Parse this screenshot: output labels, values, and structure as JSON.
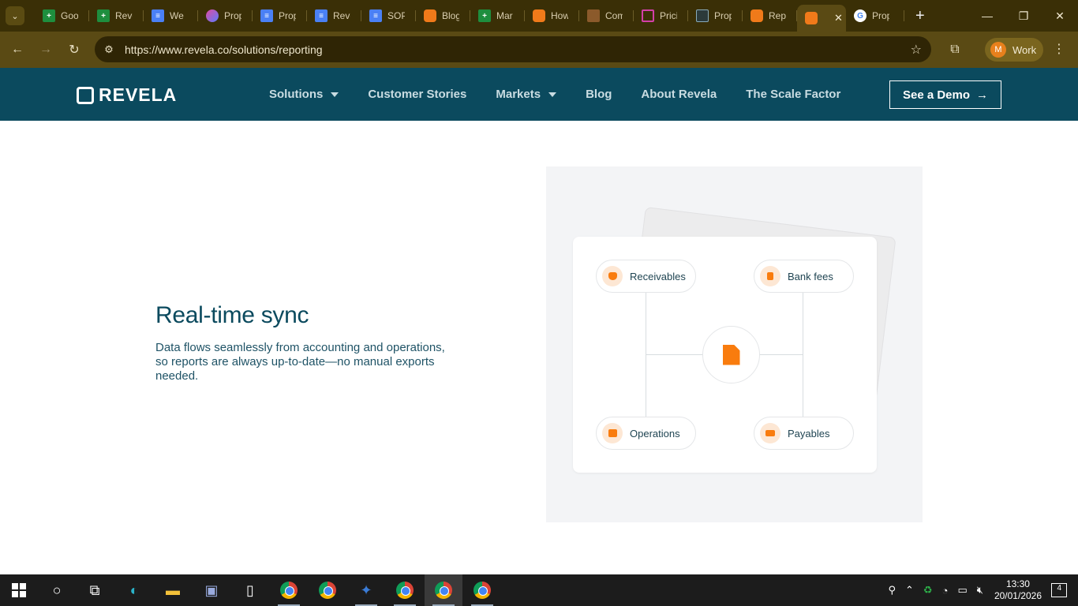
{
  "browser": {
    "tabs": [
      {
        "label": "Goo",
        "icon": "sheets-icon"
      },
      {
        "label": "Reve",
        "icon": "sheets-icon"
      },
      {
        "label": "We",
        "icon": "docs-icon"
      },
      {
        "label": "Prop",
        "icon": "gemini-icon"
      },
      {
        "label": "Prop",
        "icon": "docs-icon"
      },
      {
        "label": "Reve",
        "icon": "docs-icon"
      },
      {
        "label": "SOP",
        "icon": "docs-icon"
      },
      {
        "label": "Blog",
        "icon": "revela-icon"
      },
      {
        "label": "Mar",
        "icon": "sheets-icon"
      },
      {
        "label": "How",
        "icon": "revela-icon"
      },
      {
        "label": "Com",
        "icon": "book-icon"
      },
      {
        "label": "Prici",
        "icon": "phone-icon"
      },
      {
        "label": "Prop",
        "icon": "cursor-icon"
      },
      {
        "label": "Rep",
        "icon": "revela-icon"
      },
      {
        "label": "",
        "icon": "revela-icon",
        "active": true
      },
      {
        "label": "Prop",
        "icon": "google-icon"
      }
    ],
    "url": "https://www.revela.co/solutions/reporting",
    "profile_initial": "M",
    "profile_name": "Work"
  },
  "site": {
    "logo_text": "REVELA",
    "nav": [
      {
        "label": "Solutions",
        "dropdown": true
      },
      {
        "label": "Customer Stories",
        "dropdown": false
      },
      {
        "label": "Markets",
        "dropdown": true
      },
      {
        "label": "Blog",
        "dropdown": false
      },
      {
        "label": "About Revela",
        "dropdown": false
      },
      {
        "label": "The Scale Factor",
        "dropdown": false
      }
    ],
    "cta": "See a Demo",
    "cta_arrow": "→",
    "colors": {
      "header": "#0b4a5e",
      "accent": "#f97c0e"
    }
  },
  "section": {
    "heading": "Real-time sync",
    "description": "Data flows seamlessly from accounting and operations, so reports are always up-to-date—no manual exports needed."
  },
  "diagram": {
    "nodes": {
      "receivables": "Receivables",
      "bank_fees": "Bank fees",
      "operations": "Operations",
      "payables": "Payables"
    },
    "center_icon": "document-icon"
  },
  "taskbar": {
    "time": "13:30",
    "date": "20/01/2026",
    "notifications": "4"
  }
}
